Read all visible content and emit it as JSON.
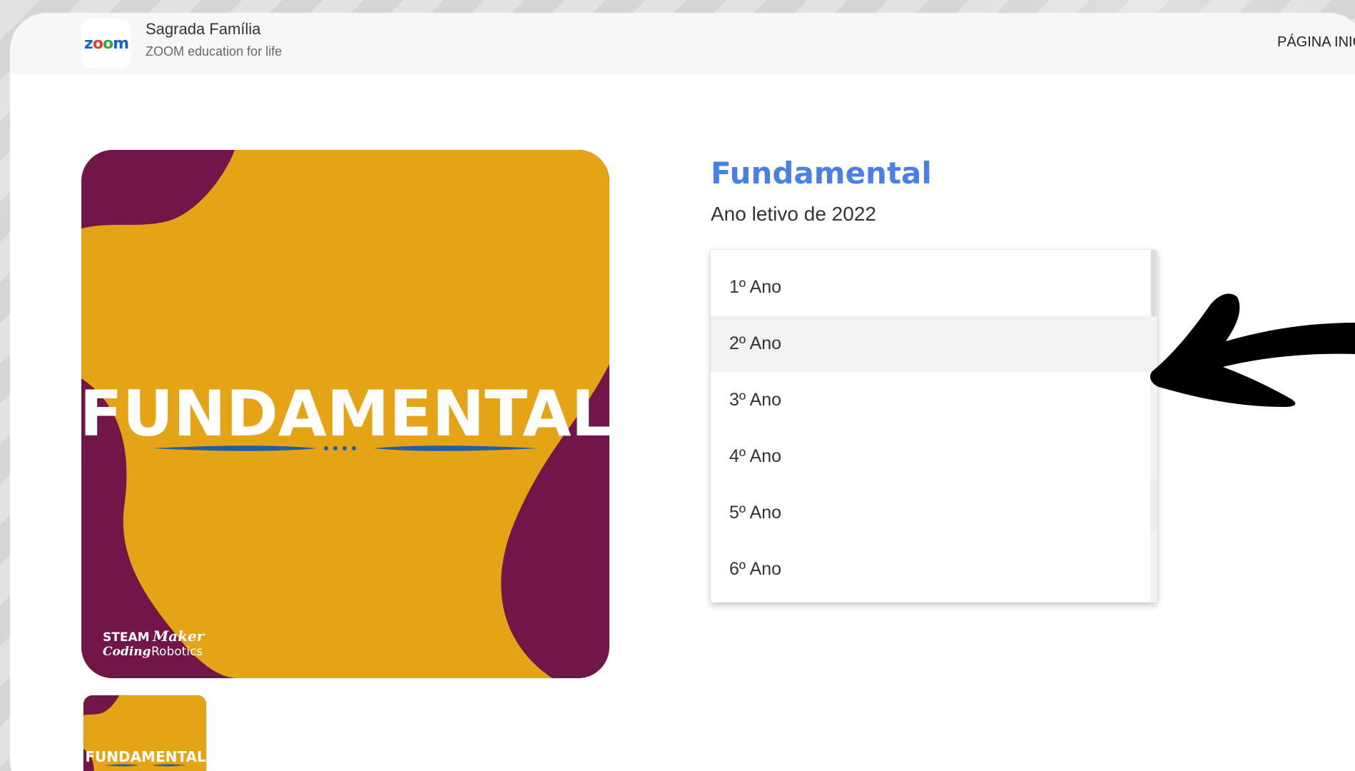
{
  "header": {
    "logo_text": "zoom",
    "store_name": "Sagrada Família",
    "store_subtitle": "ZOOM education for life",
    "nav_link": "PÁGINA INICIAL"
  },
  "product": {
    "image_text": "FUNDAMENTAL",
    "image_badge_line1_a": "STEAM",
    "image_badge_line1_b": "Maker",
    "image_badge_line2_a": "Coding",
    "image_badge_line2_b": "Robotics",
    "title": "Fundamental",
    "subtitle": "Ano letivo de 2022"
  },
  "dropdown": {
    "options": [
      "1º Ano",
      "2º Ano",
      "3º Ano",
      "4º Ano",
      "5º Ano",
      "6º Ano"
    ],
    "hovered_index": 1
  },
  "colors": {
    "accent": "#4a7fe6",
    "image_mustard": "#e5a316",
    "image_purple": "#721649",
    "image_blue": "#1e5fa8"
  },
  "icons": [
    "zoom-logo-icon",
    "pointer-arrow-icon"
  ]
}
